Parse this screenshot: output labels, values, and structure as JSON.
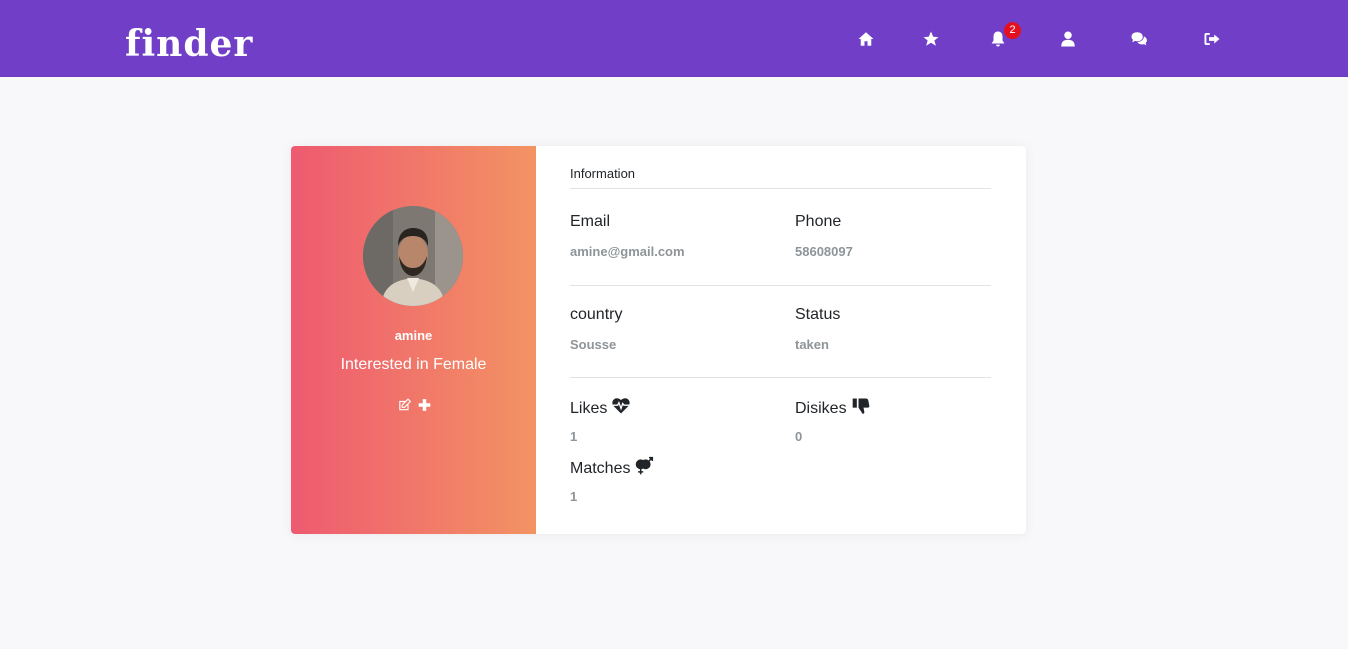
{
  "navbar": {
    "logo": "finder",
    "notification_count": "2",
    "icons": [
      "home-icon",
      "star-icon",
      "bell-icon",
      "user-icon",
      "comments-icon",
      "sign-out-icon"
    ]
  },
  "colors": {
    "navbar_bg": "#713fc7",
    "card_gradient_start": "#ee5a70",
    "card_gradient_end": "#f39363",
    "badge": "#e3101f"
  },
  "profile": {
    "username": "amine",
    "interest": "Interested in Female",
    "actions": [
      "edit-icon",
      "plus-icon"
    ]
  },
  "information": {
    "title": "Information",
    "email_label": "Email",
    "email_value": "amine@gmail.com",
    "phone_label": "Phone",
    "phone_value": "58608097",
    "country_label": "country",
    "country_value": "Sousse",
    "status_label": "Status",
    "status_value": "taken",
    "likes_label": "Likes",
    "likes_value": "1",
    "dislikes_label": "Disikes",
    "dislikes_value": "0",
    "matches_label": "Matches",
    "matches_value": "1"
  }
}
